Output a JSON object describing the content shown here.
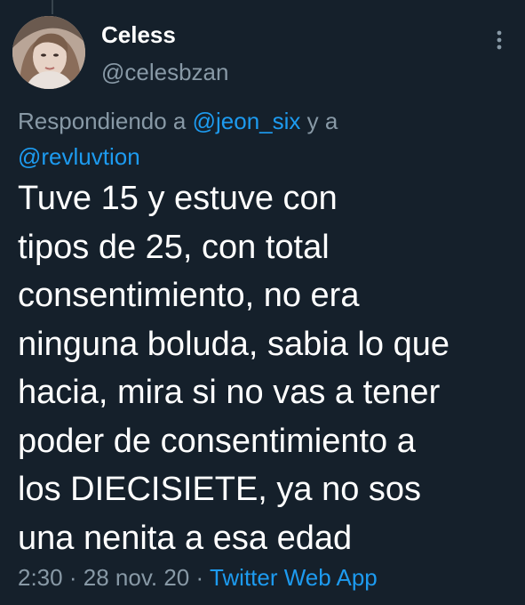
{
  "tweet": {
    "author": {
      "display_name": "Celess",
      "handle": "@celesbzan"
    },
    "reply_context": {
      "prefix": "Respondiendo a",
      "mentions": [
        "@jeon_six",
        "@revluvtion"
      ],
      "conjunction": "y a"
    },
    "text_lines": [
      "Tuve 15 y estuve con",
      "tipos de 25, con total",
      "consentimiento, no era",
      "ninguna boluda, sabia lo que",
      "hacia, mira si no vas a tener",
      "poder de consentimiento a",
      "los DIECISIETE, ya no sos",
      "una nenita a esa edad"
    ],
    "time": "2:30",
    "separator": "·",
    "date": "28 nov. 20",
    "source": "Twitter Web App"
  },
  "icons": {
    "more": "more-vertical-icon",
    "avatar": "user-avatar-photo"
  },
  "colors": {
    "background": "#15202b",
    "text_primary": "#ffffff",
    "text_secondary": "#8899a6",
    "link": "#1d9bf0",
    "thread_line": "#38444d"
  }
}
